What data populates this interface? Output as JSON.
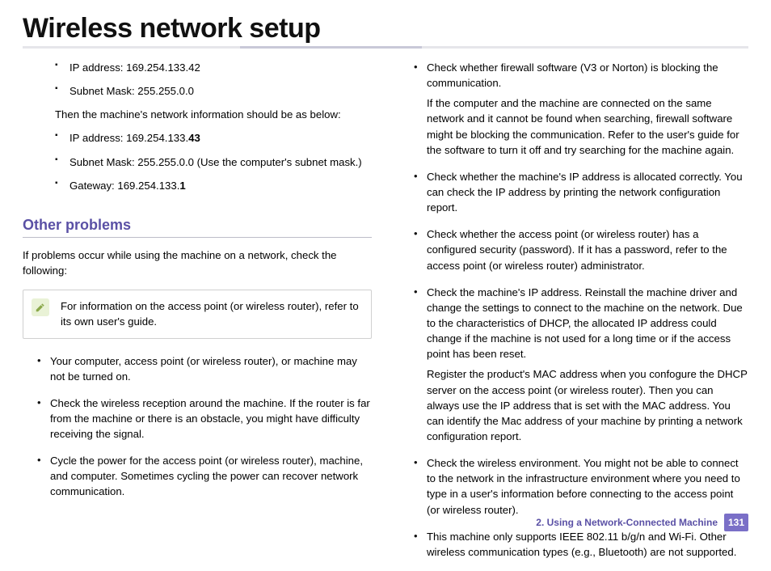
{
  "title": "Wireless network setup",
  "left": {
    "net1": [
      "IP address: 169.254.133.42",
      "Subnet Mask: 255.255.0.0"
    ],
    "then": "Then the machine's network information should be as below:",
    "net2": {
      "ip_prefix": "IP address: 169.254.133.",
      "ip_bold": "43",
      "subnet": "Subnet Mask: 255.255.0.0 (Use the computer's subnet mask.)",
      "gw_prefix": "Gateway: 169.254.133.",
      "gw_bold": "1"
    },
    "section": "Other problems",
    "intro": "If problems occur while using the machine on a network, check the following:",
    "note": "For information on the access point (or wireless router), refer to its own user's guide.",
    "bullets": [
      "Your computer, access point (or wireless router), or machine may not be turned on.",
      "Check the wireless reception around the machine. If the router is far from the machine or there is an obstacle, you might have difficulty receiving the signal.",
      "Cycle the power for the access point (or wireless router), machine, and computer. Sometimes cycling the power can recover network communication."
    ]
  },
  "right": {
    "firewall_lead": "Check whether firewall software (V3 or Norton) is blocking the communication.",
    "firewall_sub": "If the computer and the machine are connected on the same network and it cannot be found when searching, firewall software might be blocking the communication. Refer to the user's guide for the software to turn it off and try searching for the machine again.",
    "bullets": {
      "ip_alloc": "Check whether the machine's IP address is allocated correctly. You can check the IP address by printing the network configuration report.",
      "security": "Check whether the access point (or wireless router) has a configured security (password). If it has a password, refer to the access point (or wireless router) administrator.",
      "dhcp_lead": "Check the machine's IP address. Reinstall the machine driver and change the settings to connect to the machine on the network. Due to the characteristics of DHCP, the allocated IP address could change if the machine is not used for a long time or if the access point has been reset.",
      "dhcp_sub": "Register the product's MAC address when you confogure the DHCP server on the access point (or wireless router). Then you can always use the IP address that is set with the MAC address. You can identify the Mac address of your machine by printing a network configuration report.",
      "env": "Check the wireless environment. You might not be able to connect to the network in the infrastructure environment where you need to type in a user's information before connecting to the access point (or wireless router).",
      "ieee": "This machine only supports IEEE 802.11 b/g/n and Wi-Fi. Other wireless communication types (e.g., Bluetooth) are not supported."
    }
  },
  "footer": {
    "chapter": "2.  Using a Network-Connected Machine",
    "page": "131"
  }
}
